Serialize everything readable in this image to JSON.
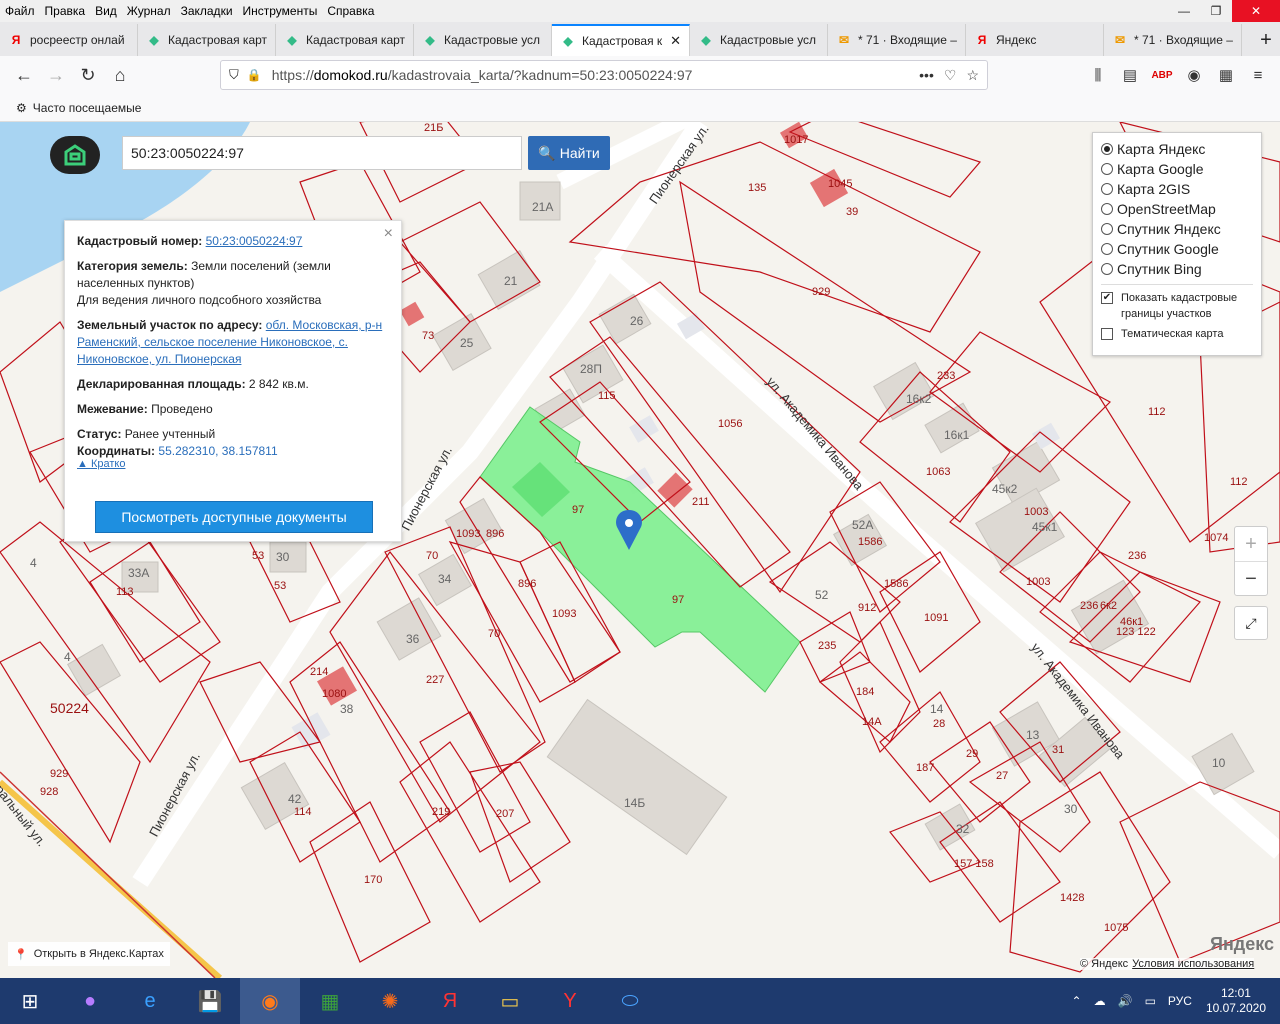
{
  "menu": [
    "Файл",
    "Правка",
    "Вид",
    "Журнал",
    "Закладки",
    "Инструменты",
    "Справка"
  ],
  "tabs": [
    {
      "label": "росреестр онлай",
      "icon": "Я",
      "color": "#e00"
    },
    {
      "label": "Кадастровая карт",
      "icon": "◆",
      "color": "#3b8"
    },
    {
      "label": "Кадастровая карт",
      "icon": "◆",
      "color": "#3b8"
    },
    {
      "label": "Кадастровые усл",
      "icon": "◆",
      "color": "#3b8"
    },
    {
      "label": "Кадастровая к",
      "icon": "◆",
      "color": "#3b8",
      "active": true
    },
    {
      "label": "Кадастровые усл",
      "icon": "◆",
      "color": "#3b8"
    },
    {
      "label": "* 71 · Входящие –",
      "icon": "✉",
      "color": "#e90"
    },
    {
      "label": "Яндекс",
      "icon": "Я",
      "color": "#e00"
    },
    {
      "label": "* 71 · Входящие –",
      "icon": "✉",
      "color": "#e90"
    }
  ],
  "url": {
    "prefix": "https://",
    "domain": "domokod.ru",
    "path": "/kadastrovaia_karta/?kadnum=50:23:0050224:97"
  },
  "bookmarks": {
    "label": "Часто посещаемые"
  },
  "search": {
    "value": "50:23:0050224:97",
    "button": "Найти"
  },
  "info": {
    "cad_label": "Кадастровый номер:",
    "cad_value": "50:23:0050224:97",
    "cat_label": "Категория земель:",
    "cat_value": "Земли поселений (земли населенных пунктов)",
    "use_value": "Для ведения личного подсобного хозяйства",
    "addr_label": "Земельный участок по адресу:",
    "addr_value": "обл. Московская, р-н Раменский, сельское поселение Никоновское, с. Никоновское, ул. Пионерская",
    "area_label": "Декларированная площадь:",
    "area_value": "2 842 кв.м.",
    "survey_label": "Межевание:",
    "survey_value": "Проведено",
    "status_label": "Статус:",
    "status_value": "Ранее учтенный",
    "coord_label": "Координаты:",
    "coord_value": "55.282310, 38.157811",
    "short_label": "Кратко",
    "docs_button": "Посмотреть доступные документы"
  },
  "layers": {
    "options": [
      "Карта Яндекс",
      "Карта Google",
      "Карта 2GIS",
      "OpenStreetMap",
      "Спутник Яндекс",
      "Спутник Google",
      "Спутник Bing"
    ],
    "selected": "Карта Яндекс",
    "show_borders": "Показать кадастровые границы участков",
    "thematic": "Тематическая карта"
  },
  "map": {
    "open_yandex": "Открыть в Яндекс.Картах",
    "logo": "Яндекс",
    "copyright": "© Яндекс",
    "terms": "Условия использования",
    "streets": [
      "Пионерская ул.",
      "ул. Академика Иванова",
      "Пионерская ул.",
      "ул. Академика Иванова",
      "Пионерская ул.",
      "ральный ул."
    ],
    "plot_labels": [
      "97",
      "97",
      "1056",
      "211",
      "115",
      "26",
      "929",
      "135",
      "1045",
      "39",
      "1017",
      "73",
      "25",
      "21",
      "21А",
      "28П",
      "233",
      "16к2",
      "16к1",
      "1063",
      "112",
      "45к2",
      "1003",
      "45к1",
      "1003",
      "236",
      "236",
      "6к2",
      "46к1",
      "123 122",
      "52А",
      "1586",
      "1586",
      "52",
      "912",
      "1091",
      "235",
      "184",
      "14А",
      "14",
      "28",
      "187",
      "29",
      "27",
      "13",
      "31",
      "30",
      "10",
      "32",
      "157 158",
      "1428",
      "1075",
      "1093",
      "896",
      "896",
      "1093",
      "70",
      "70",
      "34",
      "36",
      "227",
      "214",
      "1080",
      "38",
      "42",
      "114",
      "219",
      "207",
      "170",
      "14Б",
      "53",
      "30",
      "53",
      "33А",
      "113",
      "4",
      "4",
      "50224",
      "929",
      "928",
      "1074",
      "112",
      "21Б"
    ]
  },
  "taskbar": {
    "lang": "РУС",
    "time": "12:01",
    "date": "10.07.2020"
  }
}
